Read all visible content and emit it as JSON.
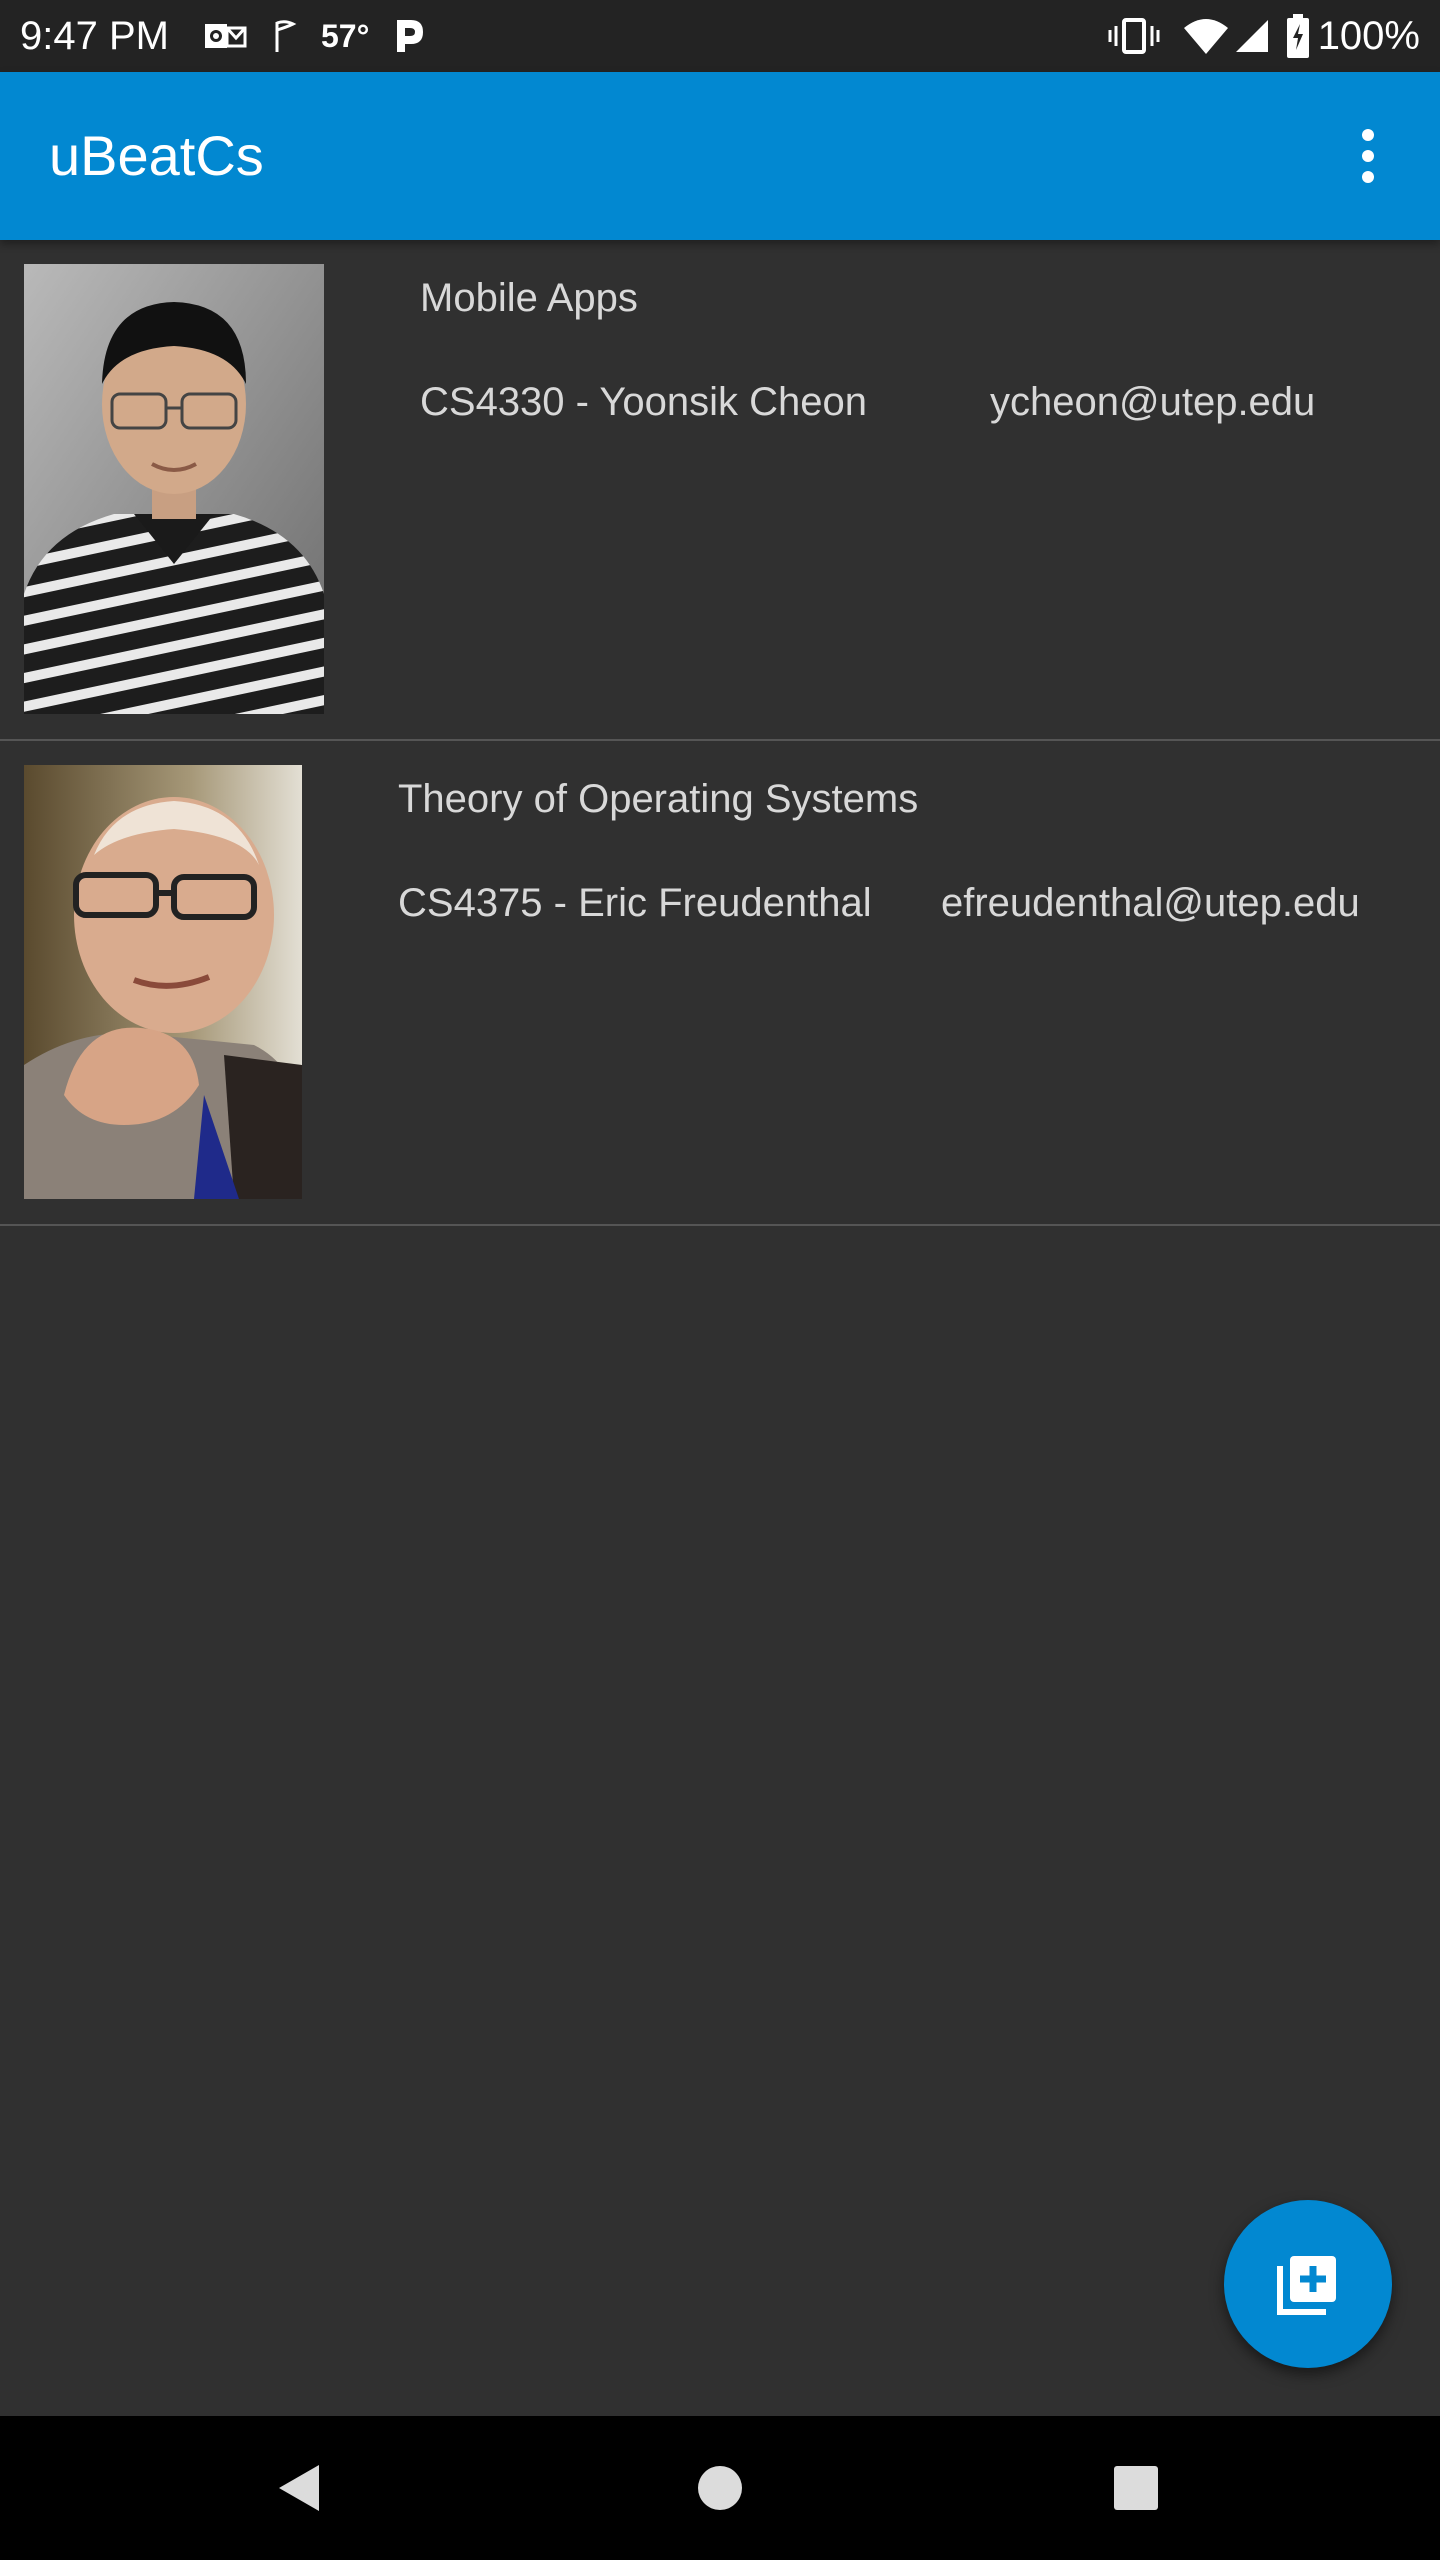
{
  "status_bar": {
    "time": "9:47 PM",
    "temperature": "57°",
    "battery": "100%",
    "icons_left": [
      "outlook-icon",
      "flag-icon",
      "pandora-icon"
    ],
    "icons_right": [
      "vibrate-icon",
      "wifi-icon",
      "cell-signal-icon",
      "battery-charging-icon"
    ]
  },
  "app_bar": {
    "title": "uBeatCs",
    "menu_icon": "more-vert-icon"
  },
  "courses": [
    {
      "name": "Mobile Apps",
      "info": "CS4330 - Yoonsik Cheon",
      "email": "ycheon@utep.edu"
    },
    {
      "name": "Theory of Operating Systems",
      "info": "CS4375 - Eric Freudenthal",
      "email": "efreudenthal@utep.edu"
    }
  ],
  "fab": {
    "icon": "add-to-library-icon"
  },
  "nav_bar": {
    "icons": [
      "back-icon",
      "home-icon",
      "recents-icon"
    ]
  },
  "colors": {
    "primary": "#0288d1",
    "background": "#303030",
    "status_bar": "#232323",
    "text": "#d8d8d8"
  }
}
